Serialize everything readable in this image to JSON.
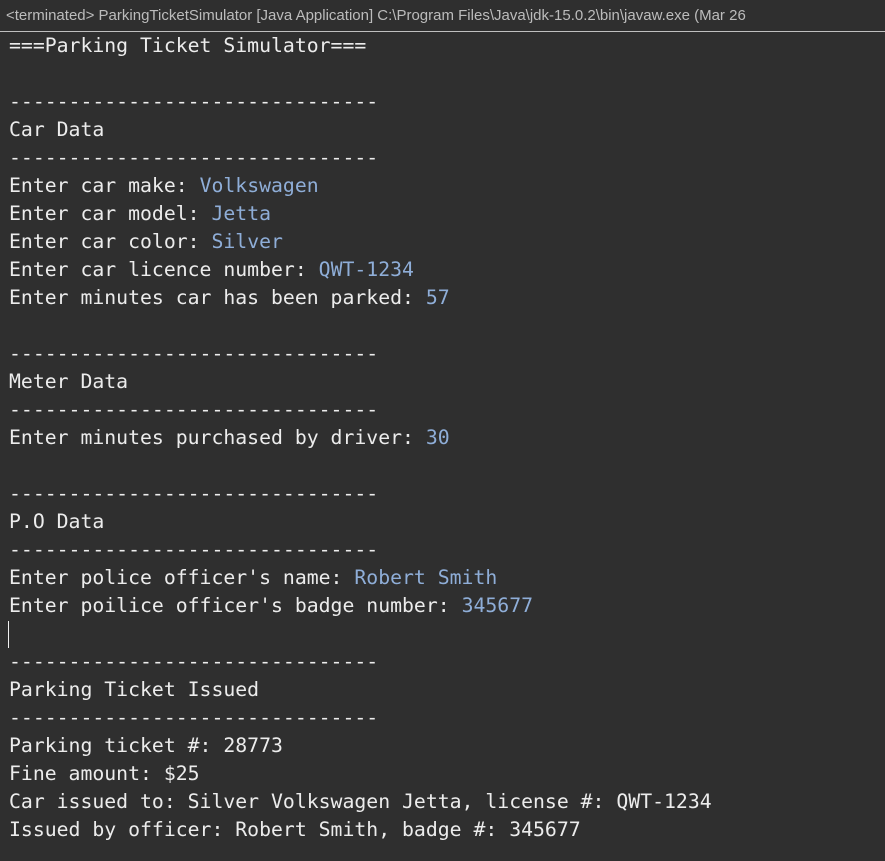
{
  "header": {
    "title": "<terminated> ParkingTicketSimulator [Java Application] C:\\Program Files\\Java\\jdk-15.0.2\\bin\\javaw.exe  (Mar 26"
  },
  "console": {
    "banner": "===Parking Ticket Simulator===",
    "separator": "-------------------------------",
    "car": {
      "heading": "Car Data",
      "make_prompt": "Enter car make: ",
      "make_value": "Volkswagen",
      "model_prompt": "Enter car model: ",
      "model_value": "Jetta",
      "color_prompt": "Enter car color: ",
      "color_value": "Silver",
      "licence_prompt": "Enter car licence number: ",
      "licence_value": "QWT-1234",
      "minutes_prompt": "Enter minutes car has been parked: ",
      "minutes_value": "57"
    },
    "meter": {
      "heading": "Meter Data",
      "purchased_prompt": "Enter minutes purchased by driver: ",
      "purchased_value": "30"
    },
    "officer": {
      "heading": "P.O Data",
      "name_prompt": "Enter police officer's name: ",
      "name_value": "Robert Smith",
      "badge_prompt": "Enter poilice officer's badge number: ",
      "badge_value": "345677"
    },
    "ticket": {
      "heading": "Parking Ticket Issued",
      "number_line": "Parking ticket #: 28773",
      "fine_line": "Fine amount: $25",
      "issued_to_line": "Car issued to: Silver Volkswagen Jetta, license #: QWT-1234",
      "issued_by_line": "Issued by officer: Robert Smith, badge #: 345677"
    }
  }
}
